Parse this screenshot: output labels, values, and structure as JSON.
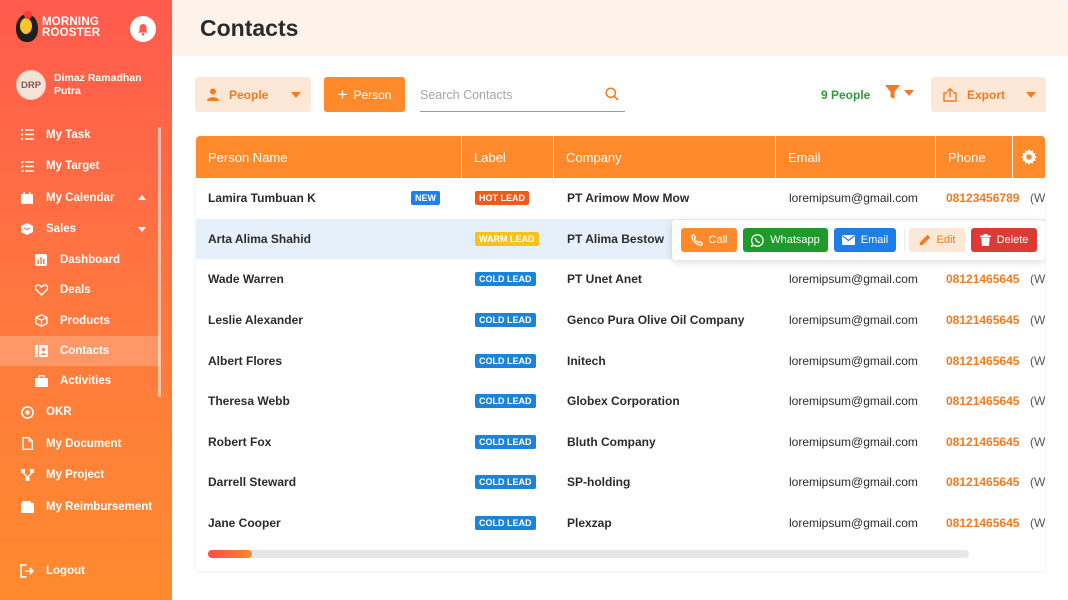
{
  "brand": {
    "line1": "Morning",
    "line2": "Rooster"
  },
  "user": {
    "initials": "DRP",
    "name": "Dimaz Ramadhan Putra"
  },
  "sidebar": {
    "items": [
      {
        "label": "My Task",
        "icon": "list-icon"
      },
      {
        "label": "My Target",
        "icon": "checklist-icon"
      },
      {
        "label": "My Calendar",
        "icon": "calendar-icon",
        "caret": "up"
      },
      {
        "label": "Sales",
        "icon": "cube-icon",
        "caret": "down"
      }
    ],
    "sub_items": [
      {
        "label": "Dashboard",
        "icon": "chart-icon"
      },
      {
        "label": "Deals",
        "icon": "handshake-icon"
      },
      {
        "label": "Products",
        "icon": "box-icon"
      },
      {
        "label": "Contacts",
        "icon": "contacts-icon",
        "active": true
      },
      {
        "label": "Activities",
        "icon": "briefcase-icon"
      }
    ],
    "items_after": [
      {
        "label": "OKR",
        "icon": "target-icon"
      },
      {
        "label": "My Document",
        "icon": "document-icon"
      },
      {
        "label": "My Project",
        "icon": "project-icon"
      },
      {
        "label": "My Reimbursement",
        "icon": "wallet-icon"
      }
    ],
    "logout": "Logout"
  },
  "header": {
    "title": "Contacts"
  },
  "toolbar": {
    "people_label": "People",
    "add_label": "Person",
    "search_placeholder": "Search Contacts",
    "people_count": "9 People",
    "export_label": "Export"
  },
  "table": {
    "columns": [
      "Person Name",
      "Label",
      "Company",
      "Email",
      "Phone"
    ],
    "rows": [
      {
        "name": "Lamira Tumbuan K",
        "new": "NEW",
        "label": "HOT LEAD",
        "label_type": "hot",
        "company": "PT Arimow Mow Mow",
        "email": "loremipsum@gmail.com",
        "phone": "08123456789",
        "phone_suffix": "(Wo"
      },
      {
        "name": "Arta Alima Shahid",
        "new": "",
        "label": "WARM LEAD",
        "label_type": "warm",
        "company": "PT Alima Bestow",
        "email": "",
        "phone": "",
        "phone_suffix": ""
      },
      {
        "name": "Wade Warren",
        "new": "",
        "label": "COLD LEAD",
        "label_type": "cold",
        "company": "PT Unet Anet",
        "email": "loremipsum@gmail.com",
        "phone": "08121465645",
        "phone_suffix": "(Wo"
      },
      {
        "name": "Leslie Alexander",
        "new": "",
        "label": "COLD LEAD",
        "label_type": "cold",
        "company": "Genco Pura Olive Oil Company",
        "email": "loremipsum@gmail.com",
        "phone": "08121465645",
        "phone_suffix": "(Wo"
      },
      {
        "name": "Albert Flores",
        "new": "",
        "label": "COLD LEAD",
        "label_type": "cold",
        "company": "Initech",
        "email": "loremipsum@gmail.com",
        "phone": "08121465645",
        "phone_suffix": "(Wo"
      },
      {
        "name": "Theresa Webb",
        "new": "",
        "label": "COLD LEAD",
        "label_type": "cold",
        "company": "Globex Corporation",
        "email": "loremipsum@gmail.com",
        "phone": "08121465645",
        "phone_suffix": "(Wo"
      },
      {
        "name": "Robert Fox",
        "new": "",
        "label": "COLD LEAD",
        "label_type": "cold",
        "company": "Bluth Company",
        "email": "loremipsum@gmail.com",
        "phone": "08121465645",
        "phone_suffix": "(Wo"
      },
      {
        "name": "Darrell Steward",
        "new": "",
        "label": "COLD LEAD",
        "label_type": "cold",
        "company": "SP-holding",
        "email": "loremipsum@gmail.com",
        "phone": "08121465645",
        "phone_suffix": "(Wo"
      },
      {
        "name": "Jane Cooper",
        "new": "",
        "label": "COLD LEAD",
        "label_type": "cold",
        "company": "Plexzap",
        "email": "loremipsum@gmail.com",
        "phone": "08121465645",
        "phone_suffix": "(Wo"
      }
    ],
    "highlight_row": 1
  },
  "row_actions": {
    "call": "Call",
    "whatsapp": "Whatsapp",
    "email": "Email",
    "edit": "Edit",
    "delete": "Delete"
  },
  "colors": {
    "accent": "#ff8a2b",
    "hot": "#f05a1a",
    "warm": "#f7c21f",
    "cold": "#1c84d8",
    "new": "#1f7ff0",
    "whatsapp": "#1f9a2b",
    "delete": "#dc3b35"
  }
}
